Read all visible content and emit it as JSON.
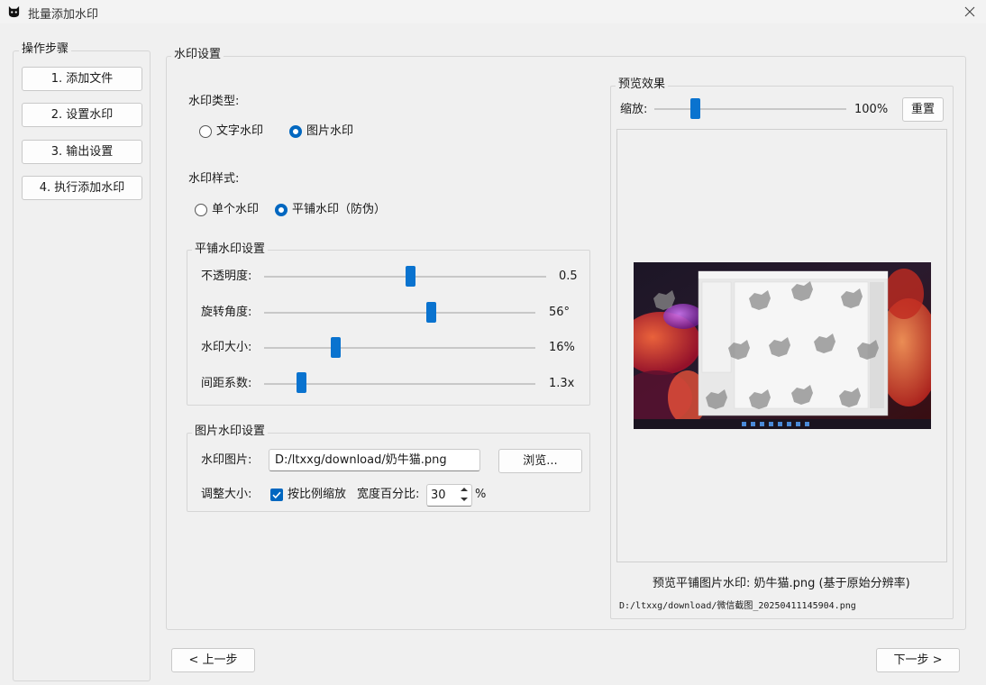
{
  "window": {
    "title": "批量添加水印"
  },
  "steps": {
    "title": "操作步骤",
    "items": [
      "1. 添加文件",
      "2. 设置水印",
      "3. 输出设置",
      "4. 执行添加水印"
    ]
  },
  "settings": {
    "title": "水印设置",
    "type_label": "水印类型:",
    "type_options": [
      "文字水印",
      "图片水印"
    ],
    "type_selected": "图片水印",
    "style_label": "水印样式:",
    "style_options": [
      "单个水印",
      "平铺水印（防伪）"
    ],
    "style_selected": "平铺水印（防伪）",
    "tile": {
      "title": "平铺水印设置",
      "opacity": {
        "label": "不透明度:",
        "value_text": "0.5",
        "fraction": 0.5
      },
      "rotation": {
        "label": "旋转角度:",
        "value_text": "56°",
        "fraction": 0.62
      },
      "size": {
        "label": "水印大小:",
        "value_text": "16%",
        "fraction": 0.27
      },
      "spacing": {
        "label": "间距系数:",
        "value_text": "1.3x",
        "fraction": 0.13
      }
    },
    "image": {
      "title": "图片水印设置",
      "file_label": "水印图片:",
      "file_value": "D:/ltxxg/download/奶牛猫.png",
      "browse_label": "浏览...",
      "resize_label": "调整大小:",
      "proportional_label": "按比例缩放",
      "proportional_checked": true,
      "width_percent_label": "宽度百分比:",
      "width_percent_value": "30",
      "percent_unit": "%"
    }
  },
  "preview": {
    "title": "预览效果",
    "zoom_label": "缩放:",
    "zoom_value": "100%",
    "zoom_fraction": 0.2,
    "reset_label": "重置",
    "caption": "预览平铺图片水印: 奶牛猫.png (基于原始分辨率)",
    "file_path": "D:/ltxxg/download/微信截图_20250411145904.png"
  },
  "nav": {
    "prev_label": "< 上一步",
    "next_label": "下一步 >"
  },
  "colors": {
    "accent": "#0067c0",
    "slider_thumb": "#0a73cf",
    "background": "#f0f0f0"
  }
}
